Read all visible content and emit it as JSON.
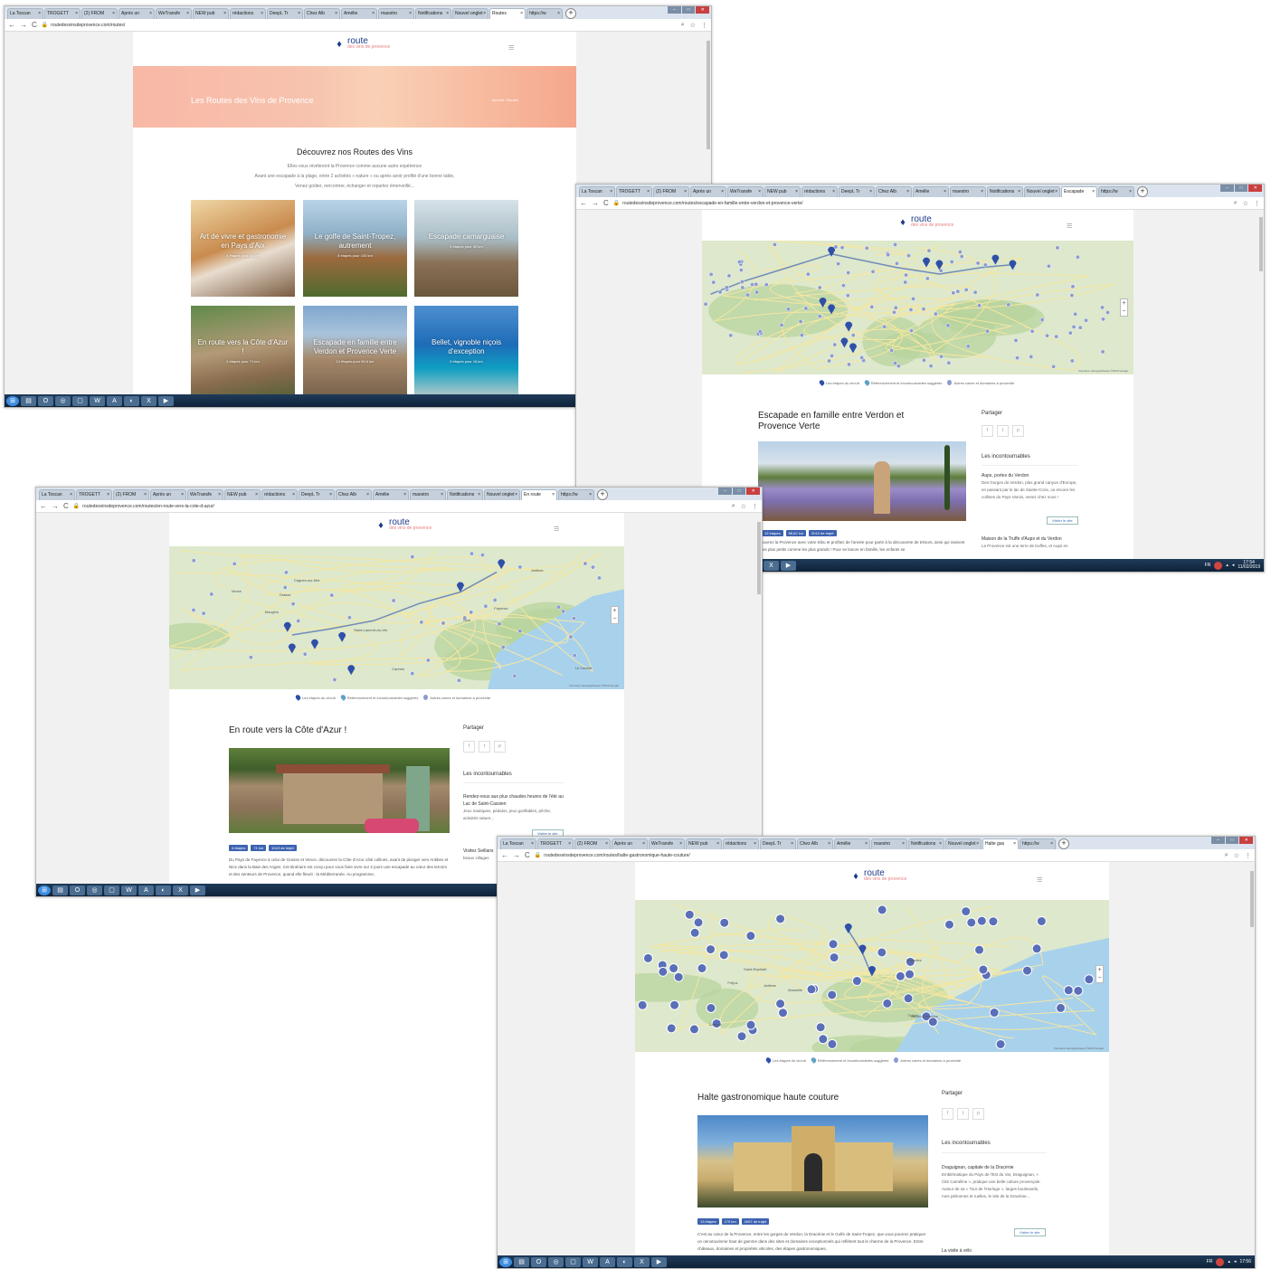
{
  "colors": {
    "brand": "#1e3a8a",
    "accent": "#e67e7e",
    "pin": "#2f4fa8",
    "pill": "#3d63b0",
    "water": "#a8d1ec",
    "land": "#dde8cc",
    "forest": "#b7d39b"
  },
  "icons": {
    "menu": "hamburger-icon",
    "lock": "lock-icon",
    "star": "star-icon",
    "back": "back-arrow-icon",
    "forward": "forward-arrow-icon",
    "reload": "reload-icon"
  },
  "logo": {
    "name": "route",
    "tagline": "des vins de provence"
  },
  "legend": {
    "stage": "Les étapes du circuit",
    "fav": "Référencement et incontournables suggérés",
    "other": "Autres caves et domaines à proximité"
  },
  "share": {
    "title": "Partager",
    "facebook": "f",
    "twitter": "t",
    "pinterest": "p"
  },
  "must_see": "Les incontournables",
  "visit_label": "Visiter le site",
  "zoom": {
    "in": "+",
    "out": "−"
  },
  "map_footer": "Données cartographiques ©2019 Google",
  "shot1": {
    "tabs": [
      "La Toscan",
      "TROGETT",
      "(2) FROM",
      "Après un",
      "WeTransfe",
      "NEW pub",
      "rédactions",
      "DeepL Tr",
      "Chez Alb",
      "Amélie",
      "maestro",
      "Notifications",
      "Nouvel onglet",
      "Routes",
      "https://w"
    ],
    "url": "routedesvinsdeprovence.com/routes/",
    "hero_title": "Les Routes des Vins de Provence",
    "breadcrumb": "Accueil  ›  Routes",
    "heading": "Découvrez nos Routes des Vins",
    "intro": [
      "Elles vous révéleront la Provence comme aucune autre expérience",
      "Avant une escapade à la plage, entre 2 activités « nature » ou après avoir profité d'une bonne table,",
      "Venez goûter, rencontrer, échanger et repartez émerveillé..."
    ],
    "cards": [
      {
        "title": "Art de vivre et gastronomie en Pays d'Aix",
        "sub": "4 étapes pour 28 km"
      },
      {
        "title": "Le golfe de Saint-Tropez, autrement",
        "sub": "5 étapes pour 100 km"
      },
      {
        "title": "Escapade camarguaise",
        "sub": "5 étapes pour 40 km"
      },
      {
        "title": "En route vers la Côte d'Azur !",
        "sub": "4 étapes pour 71 km"
      },
      {
        "title": "Escapade en famille entre Verdon et Provence Verte",
        "sub": "12 étapes pour 56,6 km"
      },
      {
        "title": "Bellet, vignoble niçois d'exception",
        "sub": "5 étapes pour 16 km"
      }
    ]
  },
  "shot2": {
    "tabs": [
      "La Toscan",
      "TROGETT",
      "(2) FROM",
      "Après un",
      "WeTransfe",
      "NEW pub",
      "rédactions",
      "DeepL Tr",
      "Chez Alb",
      "Amélie",
      "maestro",
      "Notifications",
      "Nouvel onglet",
      "Escapade",
      "https://w"
    ],
    "url": "routedesvinsdeprovence.com/routes/escapade-en-famille-entre-verdon-et-provence-verte/",
    "title": "Escapade en famille entre Verdon et Provence Verte",
    "pills": [
      "12 étapes",
      "56,62 km",
      "2h10 de trajet"
    ],
    "side_title": "Aups, portes du Verdon",
    "side_text": "Des Gorges du Verdon, plus grand canyon d'Europe, en passant par le lac de Sainte-Croix, ou encore les collines du Pays Varois, venez chez nous !",
    "side2_title": "Maison de la Truffe d'Aups et du Verdon",
    "side2_text": "La Provence est une terre de truffes, et Aups en",
    "desc": "ouvrez la Provence avec votre tribu et profitez de l'année pour partir à la découverte de trésors, ainsi qui ravivent les plus petits comme les plus grands ! Pour se lancer en famille, les enfants se",
    "clock": "17:54",
    "date": "11/02/2019",
    "lang": "FR"
  },
  "shot3": {
    "tabs": [
      "La Toscan",
      "TROGETT",
      "(2) FROM",
      "Après un",
      "WeTransfe",
      "NEW pub",
      "rédactions",
      "DeepL Tr",
      "Chez Alb",
      "Amélie",
      "maestro",
      "Notifications",
      "Nouvel onglet",
      "En route",
      "https://w"
    ],
    "url": "routedesvinsdeprovence.com/routes/en-route-vers-la-cote-d-azur/",
    "title": "En route vers la Côte d'Azur !",
    "pills": [
      "4 étapes",
      "71 km",
      "1h13 de trajet"
    ],
    "side_title": "Rendez-vous aux plus chaudes heures de l'été au Lac de Saint-Cassien",
    "side_text": "Jeux nautiques, pédalos, jeux gonflables, pêche, activités nature...",
    "side2_title": "Visitez Seillans",
    "side2_text": "beaux villages",
    "desc": "Du Pays de Fayence à celui de Grasse et Vence, découvrez la Côte d'Azur côté collines, avant de plonger vers Antibes et Nice dans la Baie des Anges. Cet itinéraire est conçu pour vous faire vivre sur 2 jours une escapade au cœur des terroirs et des senteurs de Provence, quand elle fleurit : la Méditerranée. Au programme,",
    "places": [
      "Nice",
      "Antibes",
      "Cannes",
      "Grasse",
      "Fayence",
      "Saint-Laurent-du-Var",
      "Cagnes-sur-Mer",
      "Le Cannet",
      "Vence",
      "Mougins"
    ]
  },
  "shot4": {
    "tabs": [
      "La Toscan",
      "TROGETT",
      "(2) FROM",
      "Après un",
      "WeTransfe",
      "NEW pub",
      "rédactions",
      "DeepL Tr",
      "Chez Alb",
      "Amélie",
      "maestro",
      "Notifications",
      "Nouvel onglet",
      "Halte gas",
      "https://w"
    ],
    "url": "routedesvinsdeprovence.com/routes/halte-gastronomique-haute-couture/",
    "title": "Halte gastronomique haute couture",
    "pills": [
      "13 étapes",
      "170 km",
      "2h57 de trajet"
    ],
    "side_title": "Draguignan, capitale de la Dracénie",
    "side_text": "Emblématique du Pays de l'Est du Var, Draguignan, « Cité Caméline », pratique une belle culture provençale. Autour de sa « Tour de l'Horloge », larges boulevards, rues piétonnes et ruelles, le site de la Dracénie...",
    "side2_title": "La visite à vélo",
    "desc": "C'est au cœur de la Provence, entre les gorges du Verdon, la Dracénie et le Golfe de Saint-Tropez, que vous pourrez pratiquer un oenotourisme haut de gamme dans des sites et domaines exceptionnels qui reflètent tout le charme de la Provence. Entre châteaux, domaines et propriétés viticoles, des étapes gastronomiques,",
    "places": [
      "Aix-en-Provence",
      "Marseille",
      "Toulon",
      "Fréjus",
      "Saint-Raphaël",
      "Antibes",
      "Cannes",
      "Brignoles"
    ],
    "clock": "17:56",
    "lang": "FR"
  }
}
